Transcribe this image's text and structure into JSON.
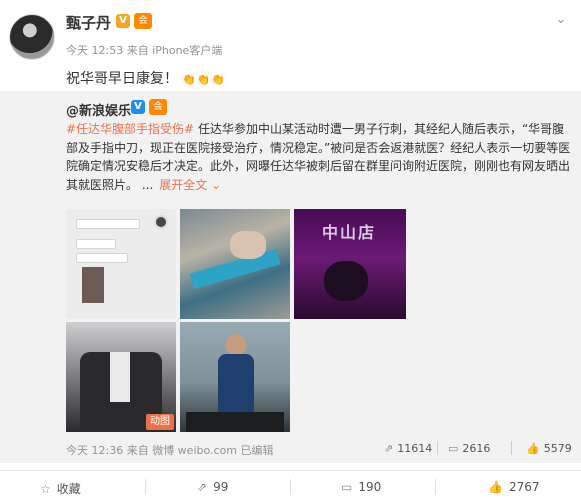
{
  "post": {
    "author": "甄子丹",
    "badges": {
      "verified": "V",
      "vip": "会"
    },
    "meta": "今天 12:53 来自 iPhone客户端",
    "content": "祝华哥早日康复！",
    "emoji": "👏👏👏"
  },
  "repost": {
    "author": "@新浪娱乐",
    "badges": {
      "verified": "V",
      "vip": "会"
    },
    "hashtag": "#任达华腹部手指受伤#",
    "text": " 任达华参加中山某活动时遭一男子行刺，其经纪人随后表示，“华哥腹部及手指中刀，现正在医院接受治疗，情况稳定。”被问是否会返港就医？经纪人表示一切要等医院确定情况安稳后才决定。此外，网曝任达华被刺后留在群里问询附近医院，刚刚也有网友晒出其就医照片。",
    "ellipsis": " ...",
    "expand": "展开全文 ⌄",
    "thumb3_sign": "中山店",
    "gif_label": "动图",
    "footer": "今天 12:36 来自 微博 weibo.com  已编辑",
    "stats": {
      "reposts": "11614",
      "comments": "2616",
      "likes": "5579"
    }
  },
  "bottom_bar": {
    "favorite": "收藏",
    "repost_count": "99",
    "comment_count": "190",
    "like_count": "2767"
  },
  "icons": {
    "chevron": "chevron-down-icon",
    "repost": "repost-icon",
    "comment": "comment-icon",
    "like": "like-icon",
    "favorite": "star-icon"
  }
}
